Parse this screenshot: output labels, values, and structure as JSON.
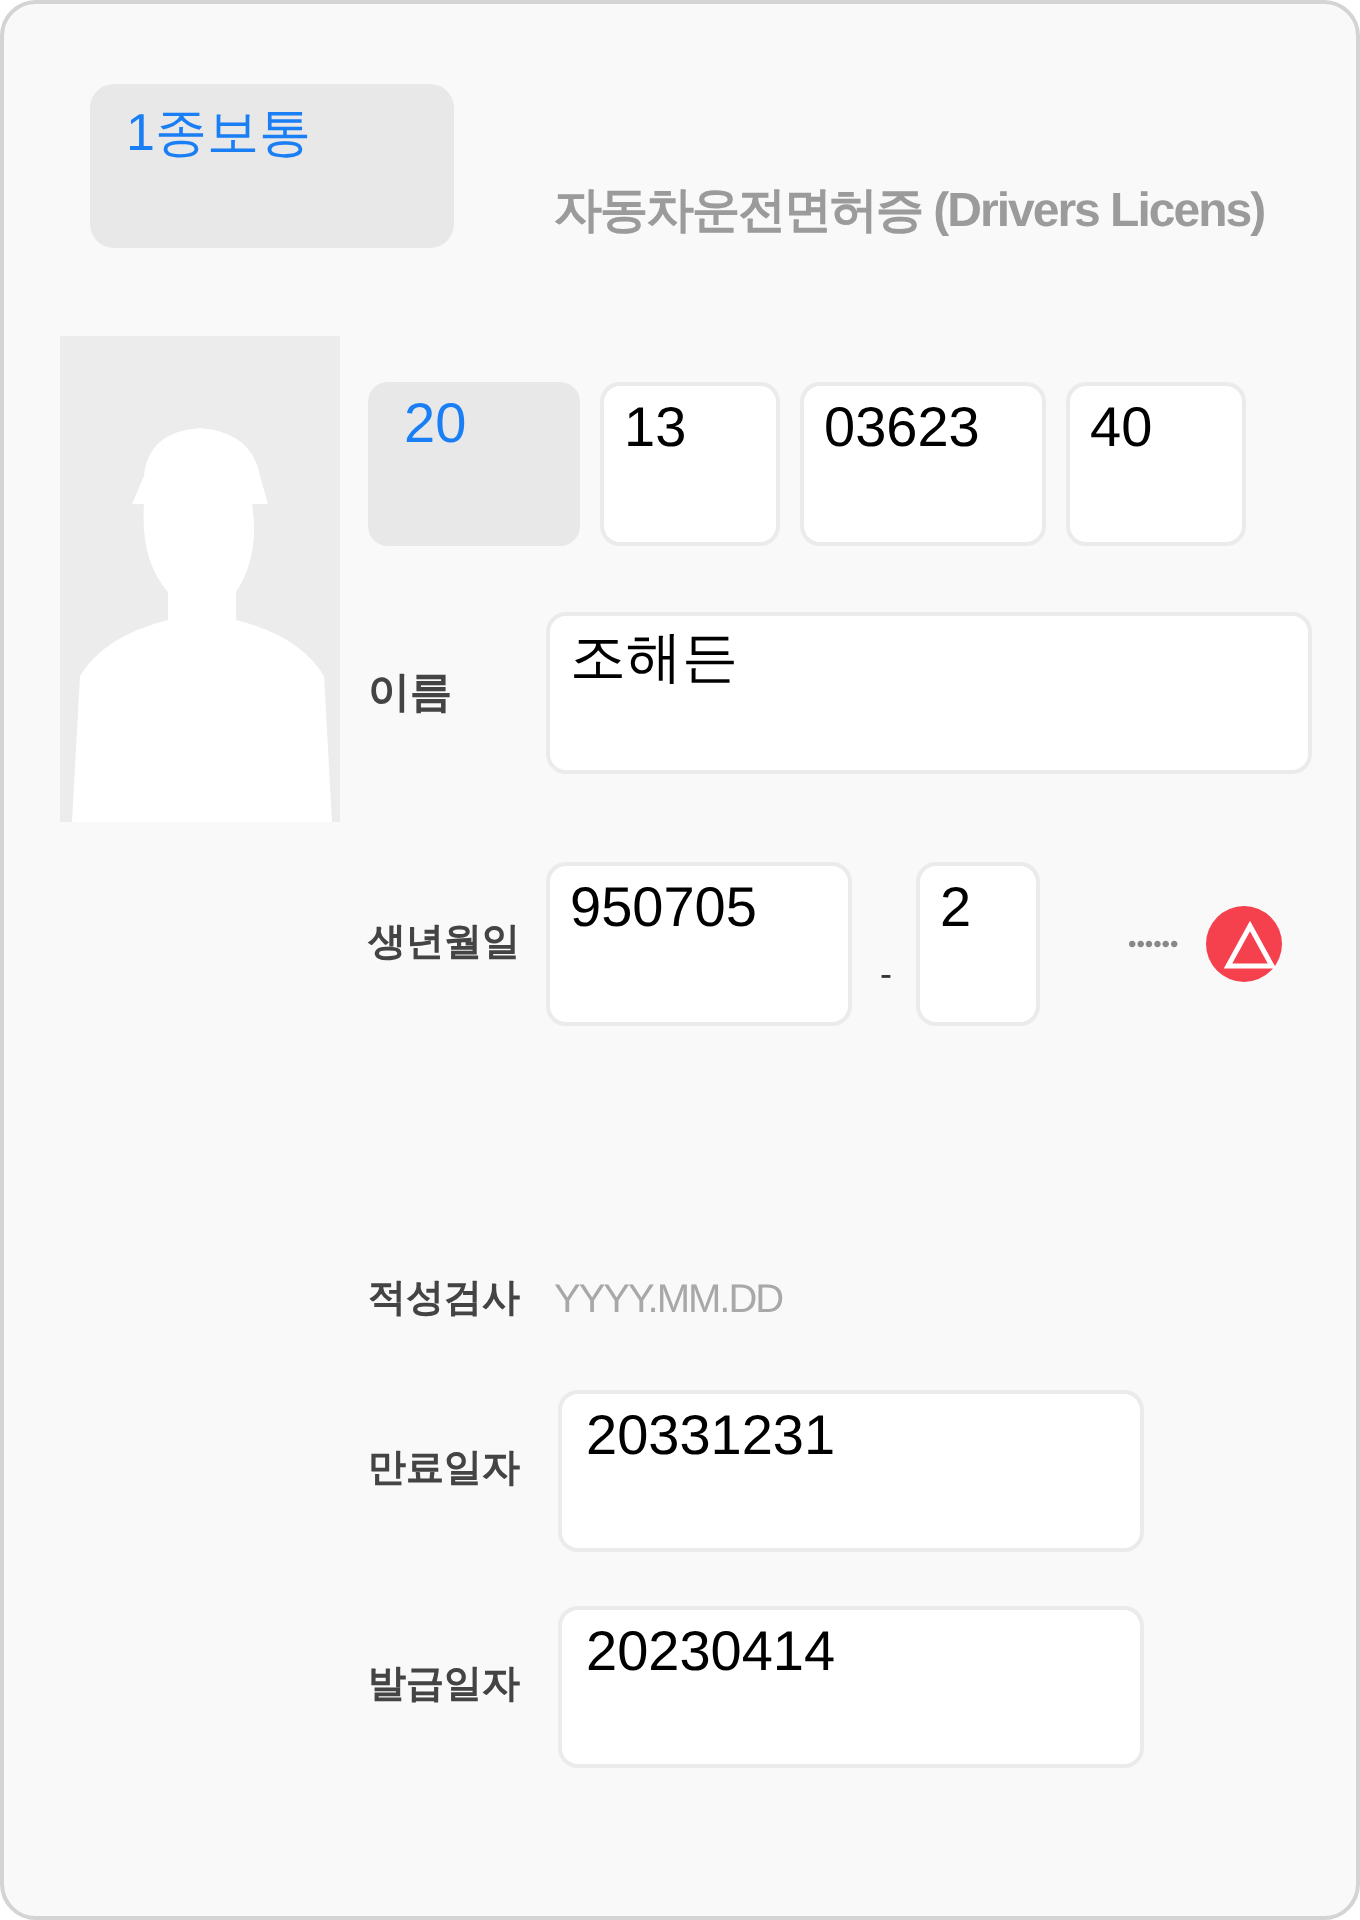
{
  "license_type": {
    "value": "1종보통"
  },
  "title": "자동차운전면허증 (Drivers Licens)",
  "license_number": [
    {
      "value": "20",
      "kind": "region"
    },
    {
      "value": "13",
      "kind": "input"
    },
    {
      "value": "03623",
      "kind": "input"
    },
    {
      "value": "40",
      "kind": "input"
    }
  ],
  "name": {
    "label": "이름",
    "value": "조해든"
  },
  "birth": {
    "label": "생년월일",
    "value": "950705",
    "separator": "-",
    "gender_digit": "2",
    "masked": "••••••"
  },
  "aptitude_test": {
    "label": "적성검사",
    "placeholder": "YYYY.MM.DD"
  },
  "expiry": {
    "label": "만료일자",
    "value": "20331231"
  },
  "issued": {
    "label": "발급일자",
    "value": "20230414"
  }
}
